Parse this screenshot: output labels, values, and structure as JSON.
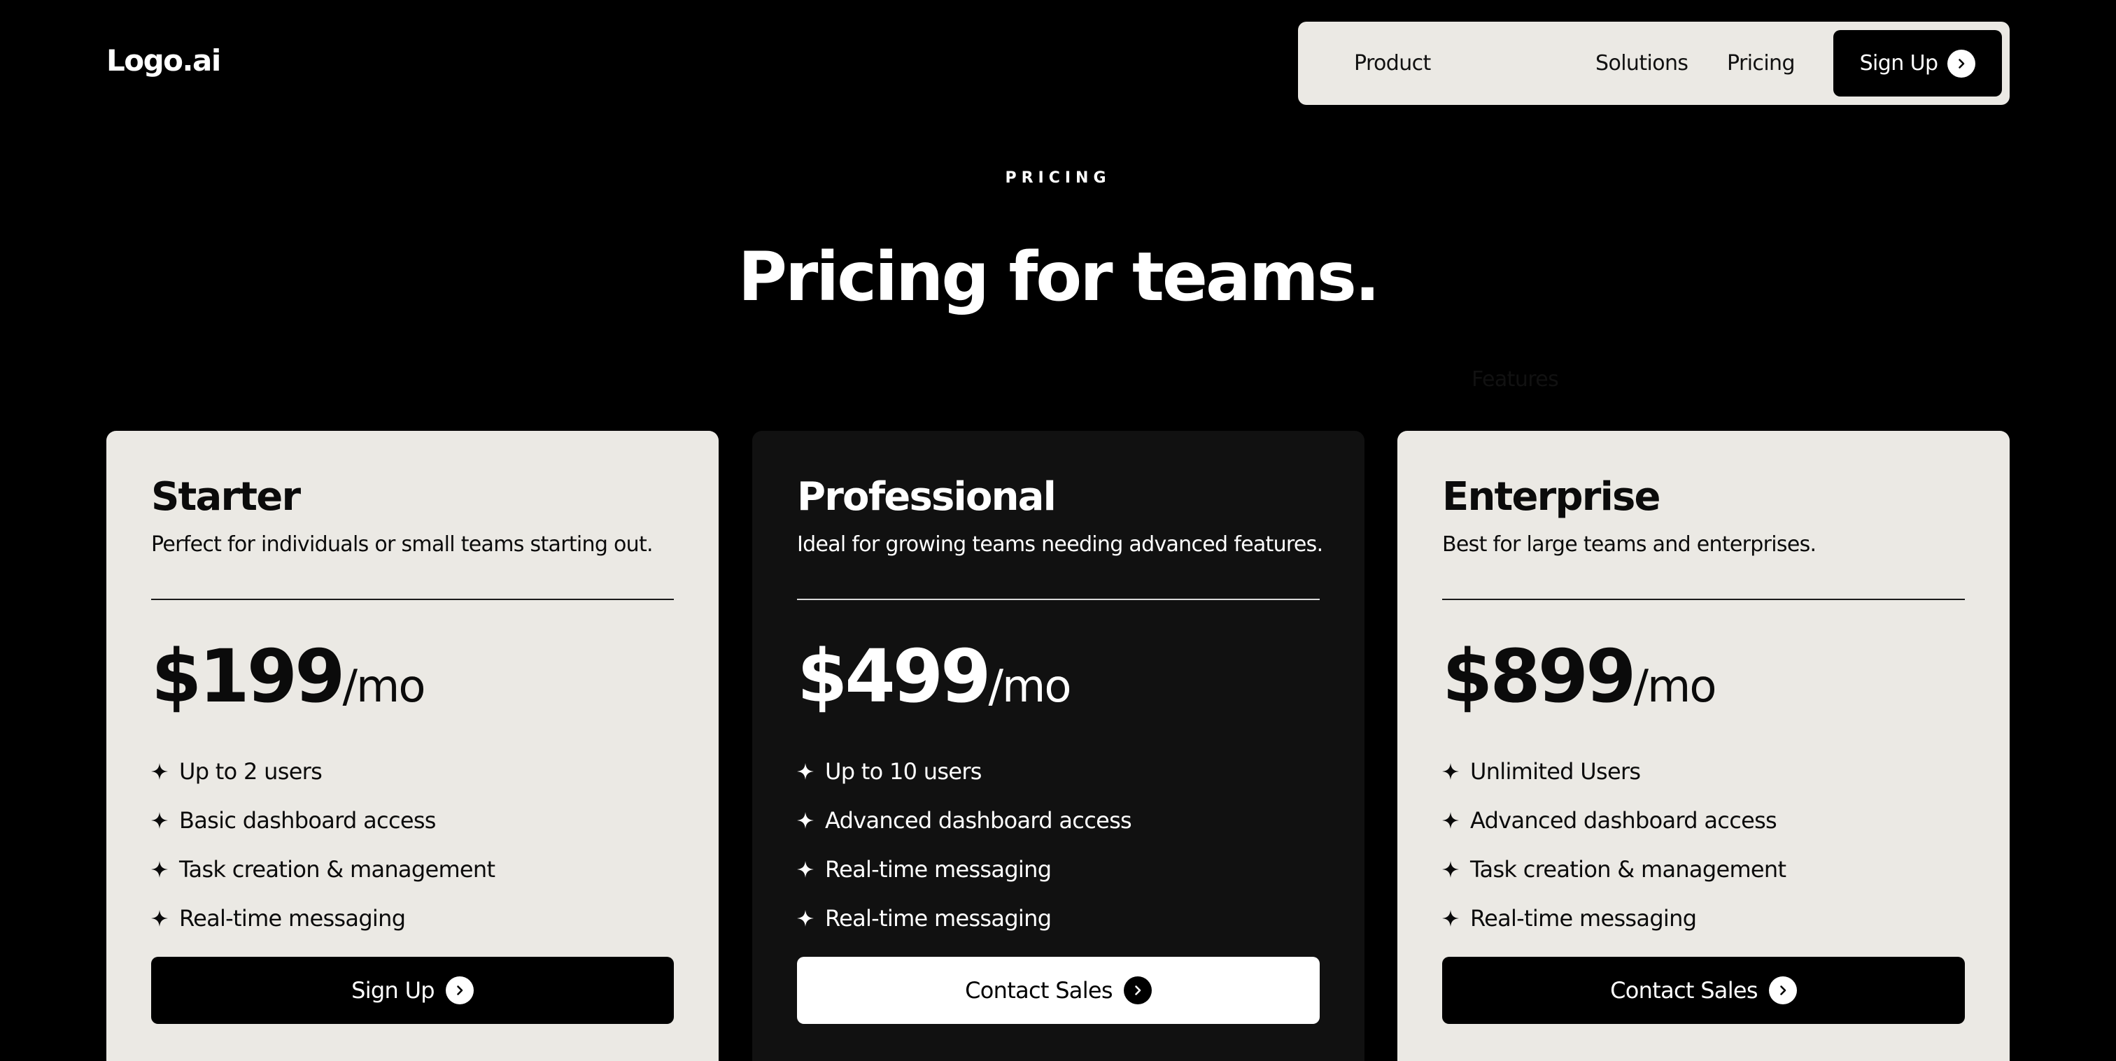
{
  "header": {
    "logo": "Logo.ai",
    "nav": {
      "product": "Product",
      "features": "Features",
      "solutions": "Solutions",
      "pricing": "Pricing",
      "cta": "Sign Up"
    }
  },
  "hero": {
    "eyebrow": "PRICING",
    "title": "Pricing for teams."
  },
  "plans": [
    {
      "name": "Starter",
      "description": "Perfect for individuals or small teams starting out.",
      "price": "$199",
      "period": "/mo",
      "features": [
        "Up to 2 users",
        "Basic dashboard access",
        "Task creation & management",
        "Real-time messaging"
      ],
      "cta": "Sign Up"
    },
    {
      "name": "Professional",
      "description": "Ideal for growing teams needing advanced features.",
      "price": "$499",
      "period": "/mo",
      "features": [
        "Up to 10 users",
        "Advanced dashboard access",
        "Real-time messaging",
        "Real-time messaging"
      ],
      "cta": "Contact Sales"
    },
    {
      "name": "Enterprise",
      "description": "Best for large teams and enterprises.",
      "price": "$899",
      "period": "/mo",
      "features": [
        "Unlimited Users",
        "Advanced dashboard access",
        "Task creation & management",
        "Real-time messaging"
      ],
      "cta": "Contact Sales"
    }
  ],
  "icons": {
    "feature_bullet": "sparkle-icon",
    "cta_arrow": "chevron-right-circle-icon"
  },
  "colors": {
    "background": "#000000",
    "light_surface": "#ebe9e4",
    "dark_surface": "#111111",
    "white": "#ffffff"
  }
}
